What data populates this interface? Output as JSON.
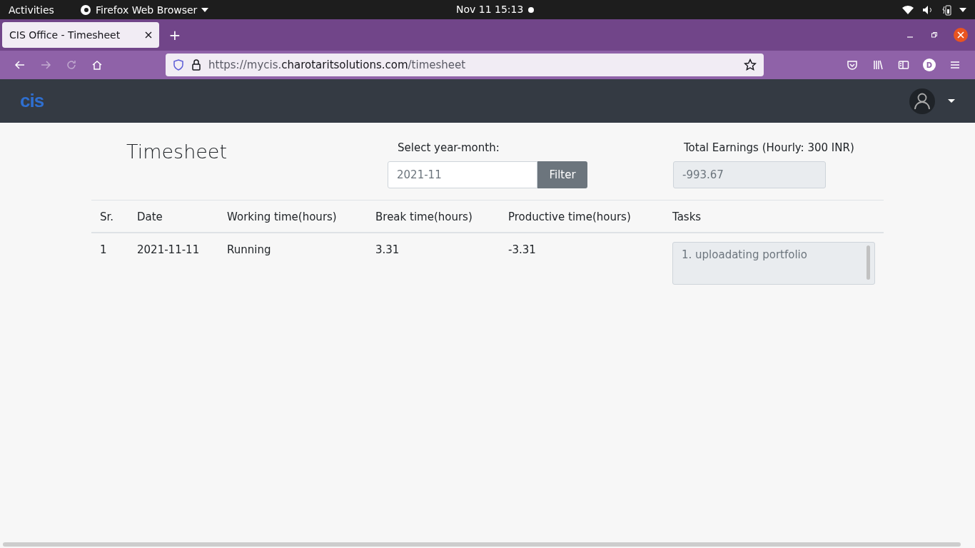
{
  "system_bar": {
    "activities": "Activities",
    "app_name": "Firefox Web Browser",
    "clock": "Nov 11  15:13"
  },
  "browser": {
    "tabs": [
      {
        "title": "CIS Office - Timesheet",
        "selected": true
      }
    ],
    "new_tab": "+",
    "url": {
      "prefix": "https://mycis.",
      "domain": "charotaritsolutions.com",
      "path": "/timesheet"
    },
    "profile_initial": "D"
  },
  "app_header": {
    "logo": "cis"
  },
  "page": {
    "title": "Timesheet",
    "month_label": "Select year-month:",
    "month_value": "2021-11",
    "filter_button": "Filter",
    "earnings_label": "Total Earnings (Hourly: 300 INR)",
    "earnings_value": "-993.67"
  },
  "table": {
    "columns": [
      "Sr.",
      "Date",
      "Working time(hours)",
      "Break time(hours)",
      "Productive time(hours)",
      "Tasks"
    ],
    "rows": [
      {
        "sr": "1",
        "date": "2021-11-11",
        "working": "Running",
        "break": "3.31",
        "productive": "-3.31",
        "tasks": "1. uploadating portfolio"
      }
    ]
  }
}
